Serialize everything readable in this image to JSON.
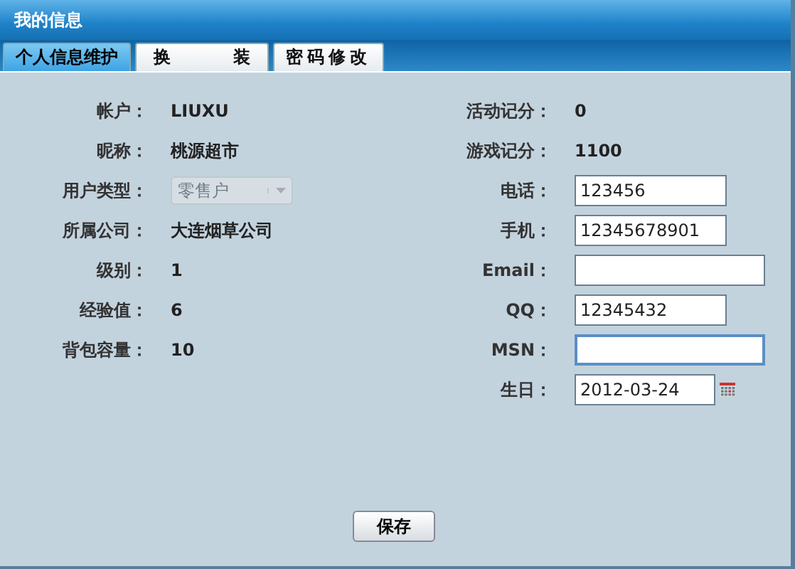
{
  "window": {
    "title": "我的信息"
  },
  "tabs": [
    {
      "label": "个人信息维护",
      "selected": true
    },
    {
      "label": "换 装",
      "selected": false
    },
    {
      "label": "密码修改",
      "selected": false
    }
  ],
  "left_fields": [
    {
      "kind": "text",
      "label": "帐户：",
      "value": "LIUXU"
    },
    {
      "kind": "text",
      "label": "昵称：",
      "value": "桃源超市"
    },
    {
      "kind": "select",
      "label": "用户类型：",
      "value": "零售户",
      "disabled": true
    },
    {
      "kind": "text",
      "label": "所属公司：",
      "value": "大连烟草公司"
    },
    {
      "kind": "text",
      "label": "级别：",
      "value": "1"
    },
    {
      "kind": "text",
      "label": "经验值：",
      "value": "6"
    },
    {
      "kind": "text",
      "label": "背包容量：",
      "value": "10"
    }
  ],
  "right_fields": [
    {
      "kind": "text",
      "label": "活动记分：",
      "value": "0"
    },
    {
      "kind": "text",
      "label": "游戏记分：",
      "value": "1100"
    },
    {
      "kind": "input",
      "label": "电话：",
      "value": "123456",
      "focused": false
    },
    {
      "kind": "input",
      "label": "手机：",
      "value": "12345678901",
      "focused": false
    },
    {
      "kind": "wide_input",
      "label": "Email：",
      "focused": false
    },
    {
      "kind": "input",
      "label": "QQ：",
      "value": "12345432",
      "focused": false
    },
    {
      "kind": "wide_input",
      "label": "MSN：",
      "focused": true
    },
    {
      "kind": "date",
      "label": "生日：",
      "value": "2012-03-24"
    }
  ],
  "save_button": "保存"
}
